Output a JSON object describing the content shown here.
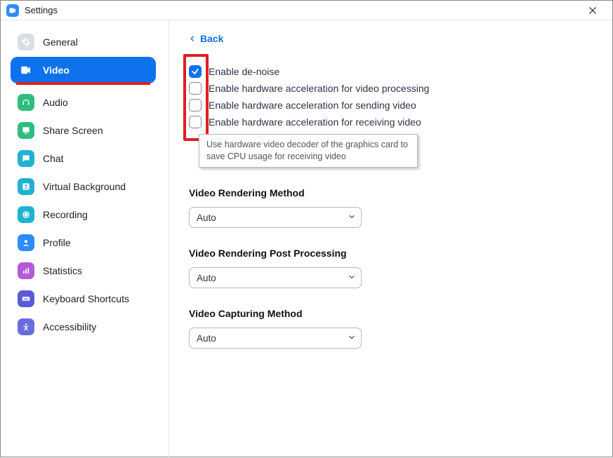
{
  "window": {
    "title": "Settings"
  },
  "sidebar": {
    "items": [
      {
        "label": "General"
      },
      {
        "label": "Video"
      },
      {
        "label": "Audio"
      },
      {
        "label": "Share Screen"
      },
      {
        "label": "Chat"
      },
      {
        "label": "Virtual Background"
      },
      {
        "label": "Recording"
      },
      {
        "label": "Profile"
      },
      {
        "label": "Statistics"
      },
      {
        "label": "Keyboard Shortcuts"
      },
      {
        "label": "Accessibility"
      }
    ],
    "active_index": 1
  },
  "main": {
    "back_label": "Back",
    "checkboxes": [
      {
        "label": "Enable de-noise",
        "checked": true
      },
      {
        "label": "Enable hardware acceleration for video processing",
        "checked": false
      },
      {
        "label": "Enable hardware acceleration for sending video",
        "checked": false
      },
      {
        "label": "Enable hardware acceleration for receiving video",
        "checked": false
      }
    ],
    "tooltip": "Use hardware video decoder of the graphics card to save CPU usage for receiving video",
    "sections": [
      {
        "title": "Video Rendering Method",
        "value": "Auto"
      },
      {
        "title": "Video Rendering Post Processing",
        "value": "Auto"
      },
      {
        "title": "Video Capturing Method",
        "value": "Auto"
      }
    ]
  },
  "colors": {
    "accent": "#0E72ED",
    "highlight": "#e02020"
  }
}
